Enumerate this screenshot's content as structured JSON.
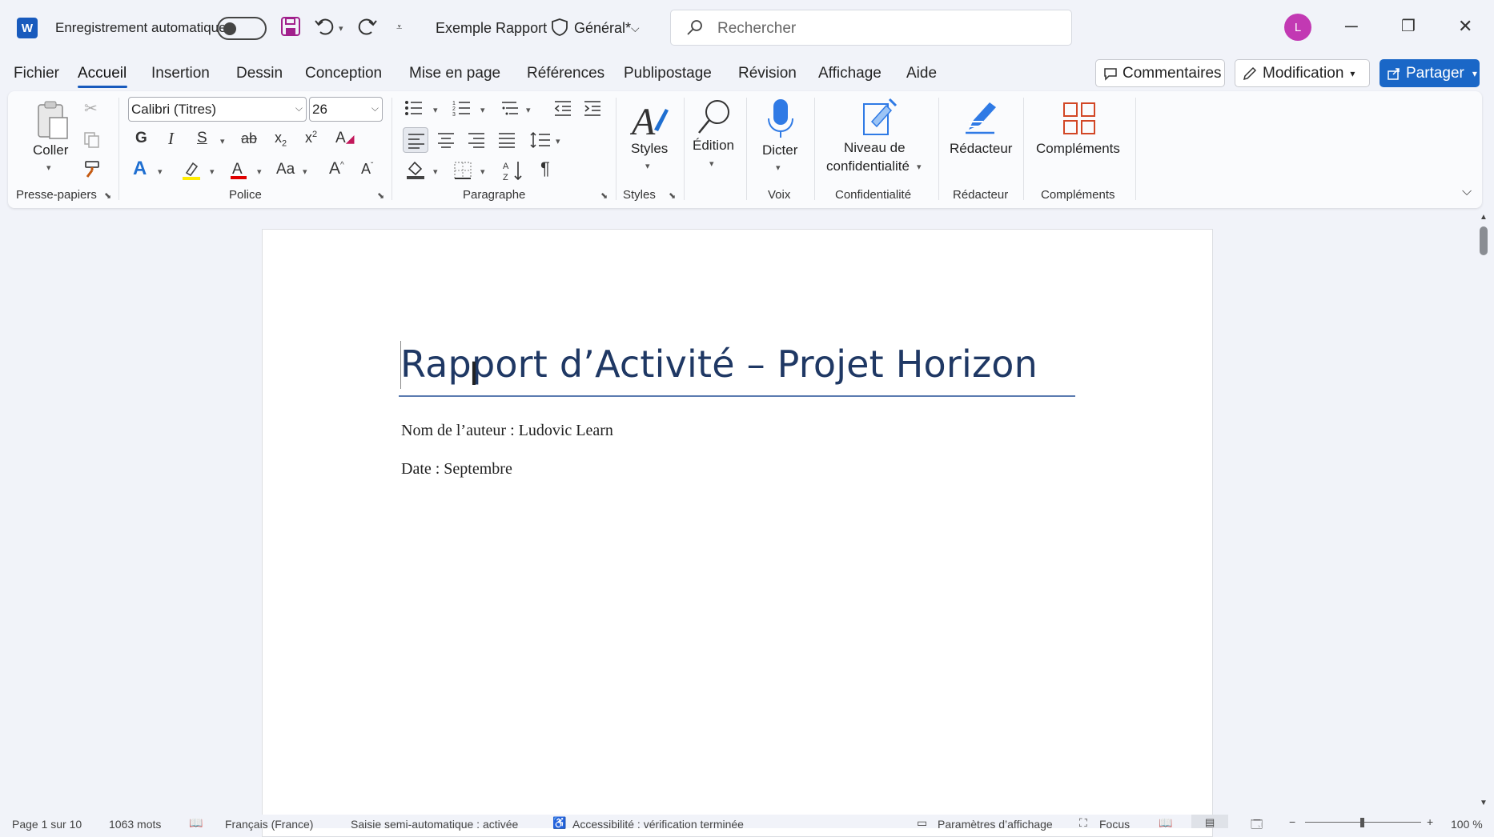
{
  "titlebar": {
    "app_icon_letter": "W",
    "autosave_label": "Enregistrement automatique",
    "document_name": "Exemple Rapport",
    "sensitivity_label": "Général*",
    "search_placeholder": "Rechercher",
    "avatar_initial": "L",
    "avatar_color": "#c239b3",
    "minimize_icon": "─",
    "restore_icon": "❐",
    "close_icon": "✕"
  },
  "menu": {
    "tabs": [
      "Fichier",
      "Accueil",
      "Insertion",
      "Dessin",
      "Conception",
      "Mise en page",
      "Références",
      "Publipostage",
      "Révision",
      "Affichage",
      "Aide"
    ],
    "active_tab": "Accueil",
    "comments_label": "Commentaires",
    "mode_label": "Modification",
    "share_label": "Partager",
    "accent_color": "#185abd"
  },
  "ribbon": {
    "clipboard": {
      "paste_label": "Coller",
      "group_label": "Presse-papiers"
    },
    "font": {
      "font_name": "Calibri (Titres)",
      "font_size": "26",
      "bold": "G",
      "italic": "I",
      "underline": "S",
      "group_label": "Police",
      "change_case": "Aa"
    },
    "paragraph": {
      "group_label": "Paragraphe"
    },
    "styles": {
      "label": "Styles",
      "group_label": "Styles"
    },
    "editing": {
      "label": "Édition"
    },
    "voice": {
      "label": "Dicter",
      "group_label": "Voix"
    },
    "sensitivity": {
      "label_line1": "Niveau de",
      "label_line2": "confidentialité",
      "group_label": "Confidentialité"
    },
    "editor": {
      "label": "Rédacteur",
      "group_label": "Rédacteur"
    },
    "addins": {
      "label": "Compléments",
      "group_label": "Compléments"
    }
  },
  "document": {
    "title": "Rapport d’Activité – Projet Horizon",
    "author_line": "Nom de l’auteur : Ludovic Learn",
    "date_line": "Date : Septembre"
  },
  "statusbar": {
    "page": "Page 1 sur 10",
    "words": "1063 mots",
    "language": "Français (France)",
    "autocomplete": "Saisie semi-automatique : activée",
    "accessibility": "Accessibilité : vérification terminée",
    "display_settings": "Paramètres d’affichage",
    "focus": "Focus",
    "zoom": "100 %"
  }
}
